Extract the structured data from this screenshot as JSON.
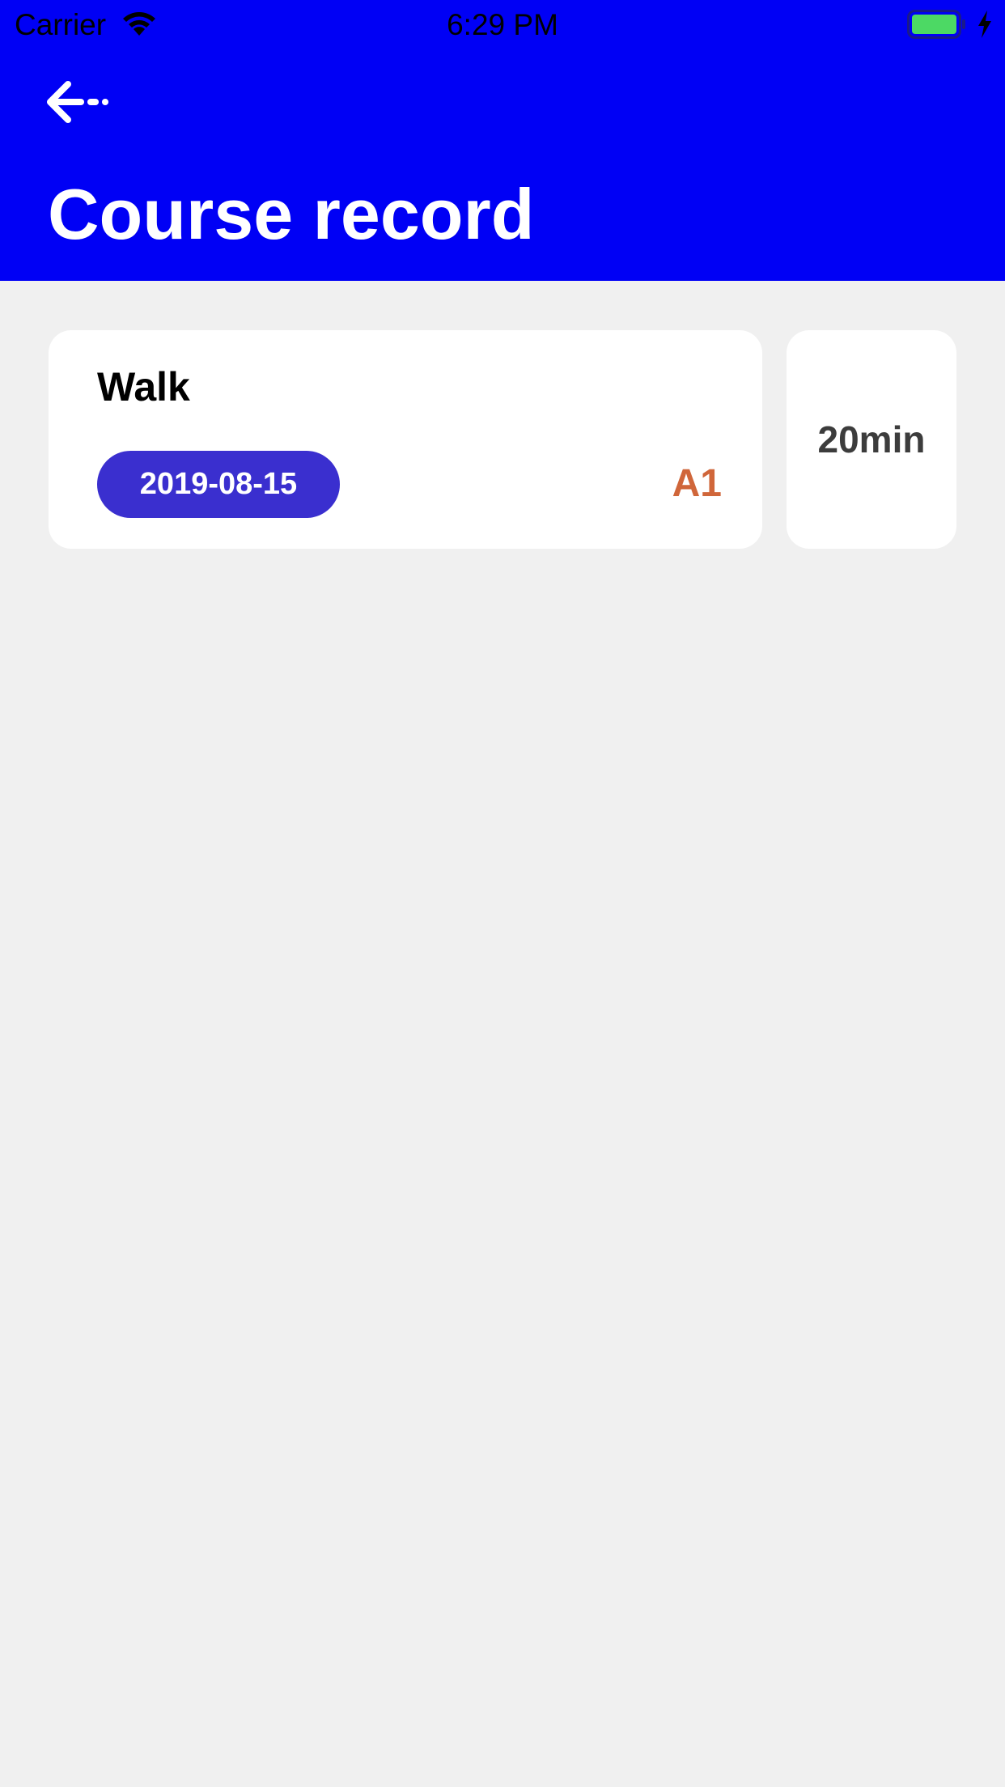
{
  "status_bar": {
    "carrier": "Carrier",
    "time": "6:29 PM",
    "battery_level": 1.0,
    "charging": true
  },
  "header": {
    "back_icon": "back-arrow-icon",
    "title": "Course record",
    "background_color": "#0000f5"
  },
  "records": [
    {
      "activity": "Walk",
      "date": "2019-08-15",
      "level": "A1",
      "duration": "20min"
    }
  ],
  "colors": {
    "date_pill": "#3a2fcf",
    "level": "#d0663a",
    "page_background": "#f0f0f0"
  }
}
